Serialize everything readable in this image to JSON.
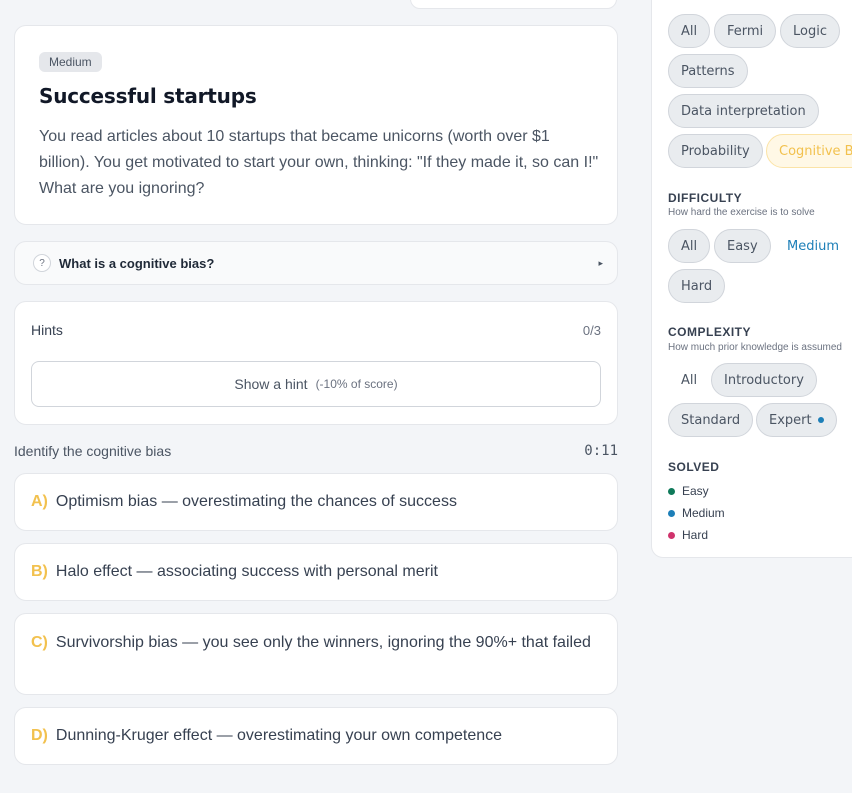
{
  "question": {
    "difficulty_badge": "Medium",
    "title": "Successful startups",
    "text": "You read articles about 10 startups that became unicorns (worth over $1 billion). You get motivated to start your own, thinking: \"If they made it, so can I!\" What are you ignoring?"
  },
  "accordion": {
    "icon_glyph": "?",
    "label": "What is a cognitive bias?",
    "arrow_glyph": "▸"
  },
  "hints": {
    "title": "Hints",
    "count": "0/3",
    "button_label": "Show a hint",
    "button_sub": "(-10% of score)"
  },
  "task": {
    "label": "Identify the cognitive bias",
    "timer": "0:11"
  },
  "options": [
    {
      "letter": "A)",
      "text": "Optimism bias — overestimating the chances of success"
    },
    {
      "letter": "B)",
      "text": "Halo effect — associating success with personal merit"
    },
    {
      "letter": "C)",
      "text": "Survivorship bias — you see only the winners, ignoring the 90%+ that failed"
    },
    {
      "letter": "D)",
      "text": "Dunning-Kruger effect — overestimating your own competence"
    }
  ],
  "sidebar": {
    "category": {
      "pills": [
        "All",
        "Fermi",
        "Logic",
        "Patterns",
        "Data interpretation",
        "Probability",
        "Cognitive Bi"
      ],
      "selected": "Cognitive Bi"
    },
    "difficulty": {
      "title": "DIFFICULTY",
      "subtitle": "How hard the exercise is to solve",
      "pills": [
        "All",
        "Easy",
        "Medium",
        "Hard"
      ],
      "selected": "Medium"
    },
    "complexity": {
      "title": "COMPLEXITY",
      "subtitle": "How much prior knowledge is assumed",
      "pills": [
        "All",
        "Introductory",
        "Standard",
        "Expert"
      ],
      "selected": "All"
    },
    "solved": {
      "title": "SOLVED",
      "items": [
        "Easy",
        "Medium",
        "Hard"
      ]
    }
  },
  "colors": {
    "accent_yellow": "#f2c14e",
    "accent_blue": "#1d7fb8",
    "easy": "#0f7a5a",
    "medium": "#1d7fb8",
    "hard": "#d0336c"
  }
}
